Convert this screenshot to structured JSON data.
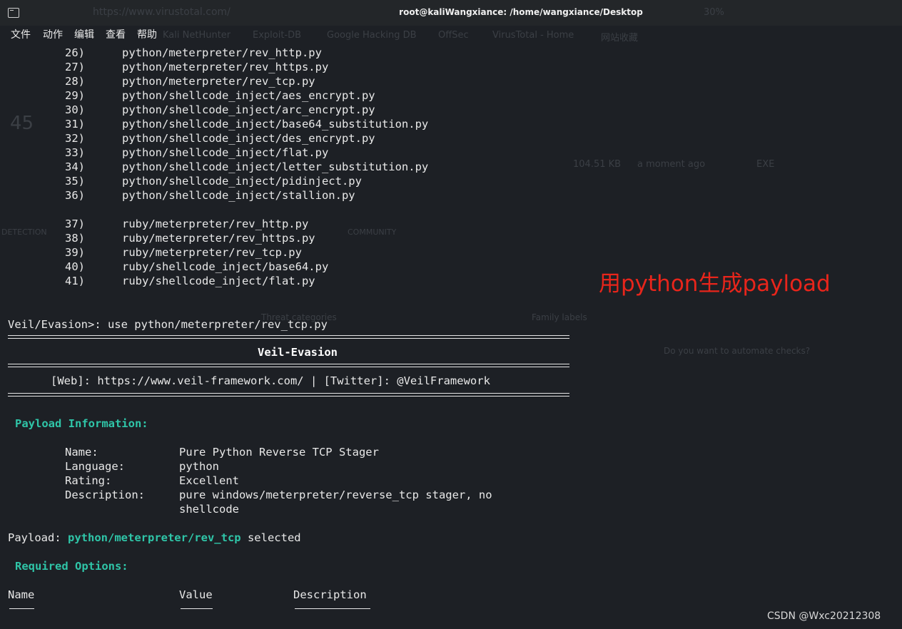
{
  "window": {
    "title": "root@kaliWangxiance: /home/wangxiance/Desktop"
  },
  "menu": [
    "文件",
    "动作",
    "编辑",
    "查看",
    "帮助"
  ],
  "payload_list_a": [
    {
      "num": "26)",
      "path": "python/meterpreter/rev_http.py"
    },
    {
      "num": "27)",
      "path": "python/meterpreter/rev_https.py"
    },
    {
      "num": "28)",
      "path": "python/meterpreter/rev_tcp.py"
    },
    {
      "num": "29)",
      "path": "python/shellcode_inject/aes_encrypt.py"
    },
    {
      "num": "30)",
      "path": "python/shellcode_inject/arc_encrypt.py"
    },
    {
      "num": "31)",
      "path": "python/shellcode_inject/base64_substitution.py"
    },
    {
      "num": "32)",
      "path": "python/shellcode_inject/des_encrypt.py"
    },
    {
      "num": "33)",
      "path": "python/shellcode_inject/flat.py"
    },
    {
      "num": "34)",
      "path": "python/shellcode_inject/letter_substitution.py"
    },
    {
      "num": "35)",
      "path": "python/shellcode_inject/pidinject.py"
    },
    {
      "num": "36)",
      "path": "python/shellcode_inject/stallion.py"
    }
  ],
  "payload_list_b": [
    {
      "num": "37)",
      "path": "ruby/meterpreter/rev_http.py"
    },
    {
      "num": "38)",
      "path": "ruby/meterpreter/rev_https.py"
    },
    {
      "num": "39)",
      "path": "ruby/meterpreter/rev_tcp.py"
    },
    {
      "num": "40)",
      "path": "ruby/shellcode_inject/base64.py"
    },
    {
      "num": "41)",
      "path": "ruby/shellcode_inject/flat.py"
    }
  ],
  "command": "Veil/Evasion>: use python/meterpreter/rev_tcp.py",
  "banner": {
    "title": "Veil-Evasion",
    "links": "[Web]: https://www.veil-framework.com/ | [Twitter]: @VeilFramework"
  },
  "payload_info": {
    "header": "Payload Information:",
    "rows": [
      {
        "label": "Name:",
        "value": "Pure Python Reverse TCP Stager"
      },
      {
        "label": "Language:",
        "value": "python"
      },
      {
        "label": "Rating:",
        "value": "Excellent"
      },
      {
        "label": "Description:",
        "value": "pure windows/meterpreter/reverse_tcp stager, no"
      }
    ],
    "description_cont": "shellcode"
  },
  "selected": {
    "prefix": "Payload: ",
    "payload": "python/meterpreter/rev_tcp",
    "suffix": " selected"
  },
  "required": {
    "header": "Required Options:",
    "columns": [
      "Name",
      "Value",
      "Description"
    ]
  },
  "annotation": "用python生成payload",
  "watermark": "CSDN @Wxc20212308",
  "background_ghost": {
    "url": "https://www.virustotal.com/",
    "bookmarks": [
      "Kali NetHunter",
      "Exploit-DB",
      "Google Hacking DB",
      "OffSec",
      "VirusTotal - Home",
      "网站收藏"
    ],
    "zoom": "30%",
    "score": "45",
    "size": "104.51 KB",
    "time": "a moment ago",
    "filetype": "EXE",
    "tabs": [
      "DETECTION",
      "COMMUNITY"
    ],
    "labels": [
      "Threat categories",
      "Family labels",
      "Do you want to automate checks?"
    ]
  },
  "colors": {
    "accent_cyan": "#2fc5a8",
    "annotation_red": "#e8251b",
    "background": "#1d2025"
  }
}
